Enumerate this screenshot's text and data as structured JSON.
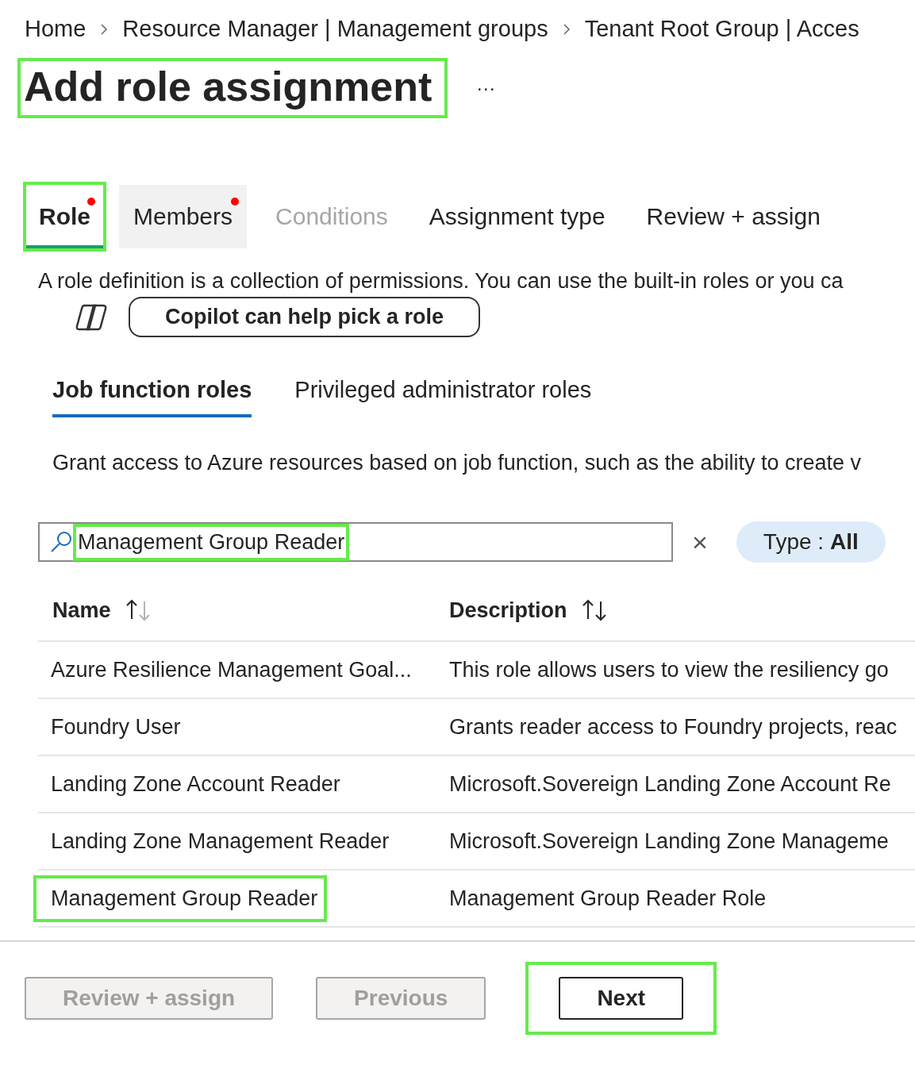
{
  "breadcrumb": [
    "Home",
    "Resource Manager | Management groups",
    "Tenant Root Group | Acces"
  ],
  "title": {
    "text": "Add role assignment",
    "highlighted": true
  },
  "more_button": "···",
  "tabs": [
    {
      "label": "Role",
      "selected": true,
      "disabled": false,
      "required_dot": true,
      "hovered": false,
      "highlighted": true
    },
    {
      "label": "Members",
      "selected": false,
      "disabled": false,
      "required_dot": true,
      "hovered": true,
      "highlighted": false
    },
    {
      "label": "Conditions",
      "selected": false,
      "disabled": true,
      "required_dot": false,
      "hovered": false,
      "highlighted": false
    },
    {
      "label": "Assignment type",
      "selected": false,
      "disabled": false,
      "required_dot": false,
      "hovered": false,
      "highlighted": false
    },
    {
      "label": "Review + assign",
      "selected": false,
      "disabled": false,
      "required_dot": false,
      "hovered": false,
      "highlighted": false
    }
  ],
  "intro": "A role definition is a collection of permissions. You can use the built-in roles or you ca",
  "copilot_button": "Copilot can help pick a role",
  "role_tabs": [
    {
      "label": "Job function roles",
      "selected": true
    },
    {
      "label": "Privileged administrator roles",
      "selected": false
    }
  ],
  "role_description": "Grant access to Azure resources based on job function, such as the ability to create v",
  "search": {
    "value": "Management Group Reader",
    "highlighted": true
  },
  "clear_button": "×",
  "type_filter": {
    "label": "Type : ",
    "value": "All"
  },
  "table": {
    "columns": [
      {
        "label": "Name",
        "sorted": true
      },
      {
        "label": "Description",
        "sorted": false
      }
    ],
    "rows": [
      {
        "name": "Azure Resilience Management Goal...",
        "description": "This role allows users to view the resiliency go",
        "highlighted": false
      },
      {
        "name": "Foundry User",
        "description": "Grants reader access to Foundry projects, reac",
        "highlighted": false
      },
      {
        "name": "Landing Zone Account Reader",
        "description": "Microsoft.Sovereign Landing Zone Account Re",
        "highlighted": false
      },
      {
        "name": "Landing Zone Management Reader",
        "description": "Microsoft.Sovereign Landing Zone Manageme",
        "highlighted": false
      },
      {
        "name": "Management Group Reader",
        "description": "Management Group Reader Role",
        "highlighted": true
      }
    ]
  },
  "footer_buttons": [
    {
      "label": "Review + assign",
      "disabled": true,
      "highlighted": false
    },
    {
      "label": "Previous",
      "disabled": true,
      "highlighted": false
    },
    {
      "label": "Next",
      "disabled": false,
      "highlighted": true
    }
  ]
}
